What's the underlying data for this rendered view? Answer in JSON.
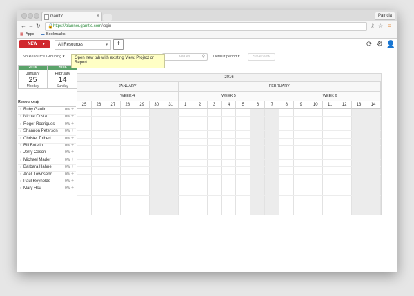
{
  "browser": {
    "tab_title": "Ganttic",
    "tab_close": "×",
    "user": "Patricia",
    "url_scheme": "https://",
    "url_host": "planner.ganttic.com",
    "url_path": "/login",
    "bookmarks": [
      "Apps",
      "Bookmarks"
    ]
  },
  "app": {
    "new_button": "NEW",
    "view_select": "All Resources",
    "add_tab_button": "+",
    "tooltip": "Open new tab with existing View, Project or Report",
    "grouping": "No Resource Grouping ▾",
    "search_placeholder": "values",
    "period": "Default period ▾",
    "save_view": "Save view",
    "icons": [
      "refresh-icon",
      "gear-icon",
      "user-icon"
    ]
  },
  "date_range": {
    "start": {
      "year": "2016",
      "month": "January",
      "day": "25",
      "weekday": "Monday"
    },
    "end": {
      "year": "2016",
      "month": "February",
      "day": "14",
      "weekday": "Sunday"
    }
  },
  "resources": {
    "header": "Resources",
    "items": [
      {
        "name": "Ruby Gaulin",
        "pct": "0%"
      },
      {
        "name": "Nicole Costa",
        "pct": "0%"
      },
      {
        "name": "Roger Rodrigues",
        "pct": "0%"
      },
      {
        "name": "Shannon Peterson",
        "pct": "0%"
      },
      {
        "name": "Christel Tolbert",
        "pct": "0%"
      },
      {
        "name": "Bill Botello",
        "pct": "0%"
      },
      {
        "name": "Jerry Cason",
        "pct": "0%"
      },
      {
        "name": "Michael Mader",
        "pct": "0%"
      },
      {
        "name": "Barbara Hahne",
        "pct": "0%"
      },
      {
        "name": "Adell Townsend",
        "pct": "0%"
      },
      {
        "name": "Paul Reynolds",
        "pct": "0%"
      },
      {
        "name": "Mary Hsu",
        "pct": "0%"
      }
    ]
  },
  "timeline": {
    "year": "2016",
    "months": [
      {
        "label": "JANUARY",
        "days": 7
      },
      {
        "label": "FEBRUARY",
        "days": 14
      }
    ],
    "weeks": [
      {
        "label": "WEEK 4",
        "days": 7
      },
      {
        "label": "WEEK 5",
        "days": 7
      },
      {
        "label": "WEEK 6",
        "days": 7
      }
    ],
    "days": [
      "25",
      "26",
      "27",
      "28",
      "29",
      "30",
      "31",
      "1",
      "2",
      "3",
      "4",
      "5",
      "6",
      "7",
      "8",
      "9",
      "10",
      "11",
      "12",
      "13",
      "14"
    ],
    "weekend_index": [
      5,
      6,
      12,
      13,
      19,
      20
    ],
    "today_index": 7
  }
}
